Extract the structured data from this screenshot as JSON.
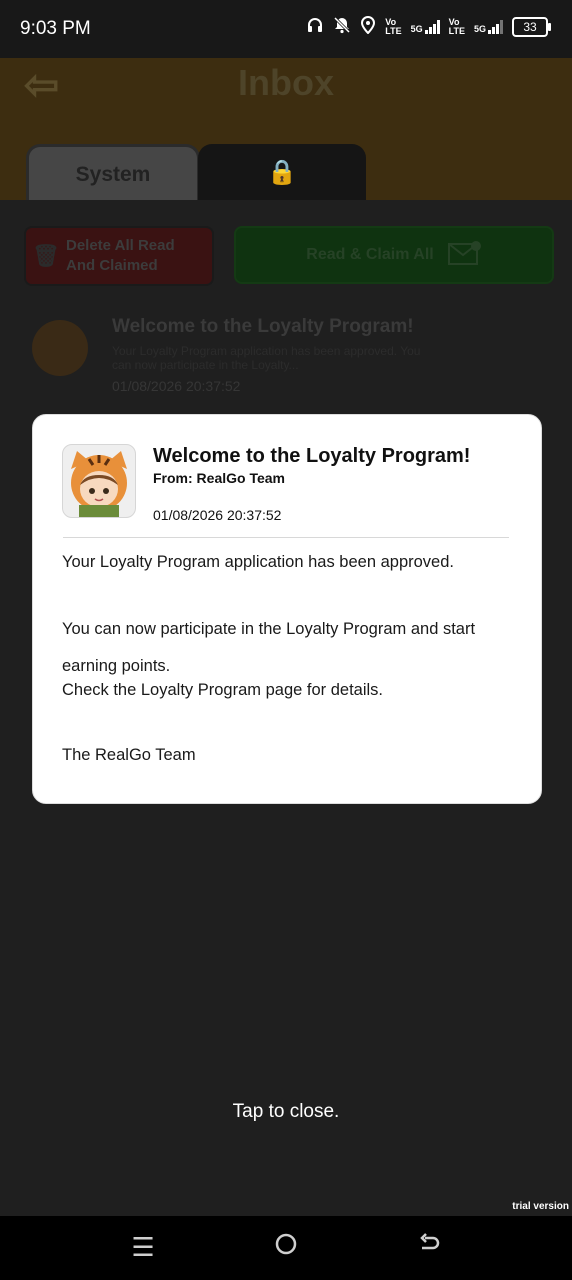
{
  "status": {
    "time": "9:03 PM",
    "net1": [
      "Vo",
      "LTE"
    ],
    "sig1": "5G",
    "net2": [
      "Vo",
      "LTE"
    ],
    "sig2": "5G",
    "battery": "33"
  },
  "background": {
    "title": "Inbox",
    "tabs": [
      "System"
    ],
    "delete_button": [
      "Delete All Read",
      "And Claimed"
    ],
    "claim_button": "Read & Claim All",
    "item": {
      "title": "Welcome to the Loyalty Program!",
      "preview": "Your Loyalty Program application has been approved. You can now participate in the Loyalty...",
      "date": "01/08/2026 20:37:52"
    }
  },
  "modal": {
    "title": "Welcome to the Loyalty Program!",
    "from": "From: RealGo Team",
    "date": "01/08/2026 20:37:52",
    "body": {
      "line1": "Your Loyalty Program application has been approved.",
      "line2": "You can now participate in the Loyalty Program and start earning points.",
      "line3": "Check the Loyalty Program page for details.",
      "signature": "The RealGo Team"
    }
  },
  "footer": {
    "tap_to_close": "Tap to close.",
    "watermark": "trial version"
  }
}
